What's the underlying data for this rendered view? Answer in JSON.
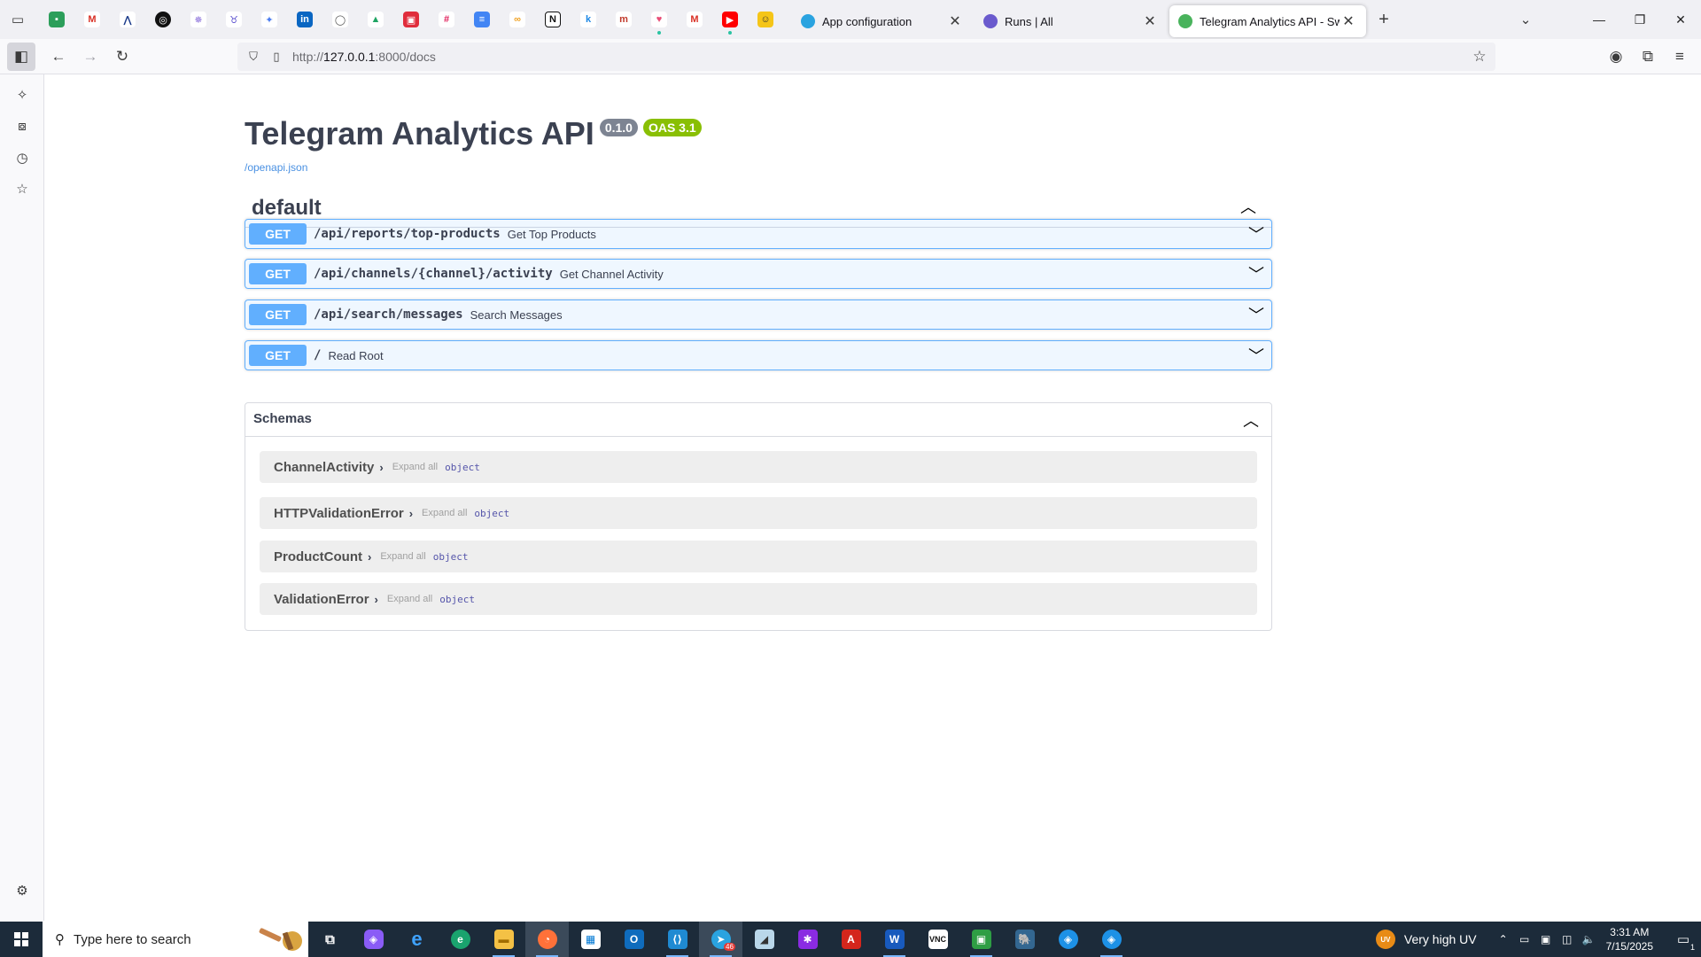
{
  "browser": {
    "tabs": [
      {
        "label": "App configuration",
        "color": "#2aa3e0"
      },
      {
        "label": "Runs | All",
        "color": "#6a5acd"
      },
      {
        "label": "Telegram Analytics API - Swagger UI",
        "color": "#49b35c"
      }
    ],
    "url_prefix": "http://",
    "url_host": "127.0.0.1",
    "url_rest": ":8000/docs"
  },
  "swagger": {
    "title": "Telegram Analytics API",
    "version_badge": "0.1.0",
    "oas_badge": "OAS 3.1",
    "spec_link": "/openapi.json",
    "tag": "default",
    "operations": [
      {
        "method": "GET",
        "path": "/api/reports/top-products",
        "summary": "Get Top Products"
      },
      {
        "method": "GET",
        "path": "/api/channels/{channel}/activity",
        "summary": "Get Channel Activity"
      },
      {
        "method": "GET",
        "path": "/api/search/messages",
        "summary": "Search Messages"
      },
      {
        "method": "GET",
        "path": "/",
        "summary": "Read Root"
      }
    ],
    "schemas_title": "Schemas",
    "schemas": [
      {
        "name": "ChannelActivity",
        "expand": "Expand all",
        "type": "object"
      },
      {
        "name": "HTTPValidationError",
        "expand": "Expand all",
        "type": "object"
      },
      {
        "name": "ProductCount",
        "expand": "Expand all",
        "type": "object"
      },
      {
        "name": "ValidationError",
        "expand": "Expand all",
        "type": "object"
      }
    ]
  },
  "taskbar": {
    "search_placeholder": "Type here to search",
    "weather": "Very high UV",
    "weather_badge": "UV",
    "time": "3:31 AM",
    "date": "7/15/2025",
    "notification_count": "1",
    "telegram_badge": "46"
  },
  "colors": {
    "get_method": "#61affe",
    "oas_badge": "#89bf04",
    "version_badge": "#7d8492"
  }
}
